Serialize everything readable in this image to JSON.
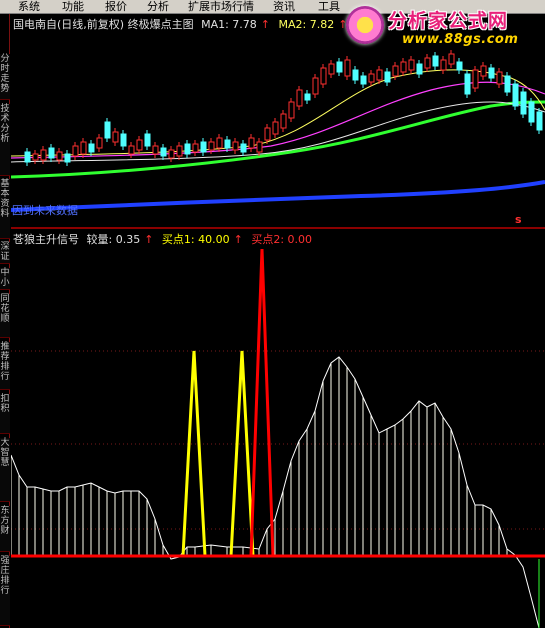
{
  "menu": [
    "系统",
    "功能",
    "报价",
    "分析",
    "扩展市场行情",
    "资讯",
    "工具"
  ],
  "left_tabs": [
    "分时走势",
    "技术分析",
    "基本资料",
    "深证",
    "中小",
    "同花顺",
    "推荐排行",
    "扣积",
    "大智慧",
    "东方财",
    "强庄排行"
  ],
  "main_header": {
    "title": "国电南自(日线,前复权) 终极爆点主图",
    "ma1_label": "MA1: 7.78",
    "ma2_label": "MA2: 7.82",
    "arrow": "↑"
  },
  "stub_text": "因到未来数据",
  "s_marker": "s",
  "indicator_header": {
    "name": "苍狼主升信号",
    "vol_label": "较量: 0.35",
    "buy1_label": "买点1: 40.00",
    "buy2_label": "买点2: 0.00",
    "arrow": "↑"
  },
  "watermark": {
    "line1": "分析家公式网",
    "line2": "www.88gs.com"
  },
  "colors": {
    "background": "#000000",
    "up_candle": "#ff3030",
    "down_candle": "#50ffff",
    "ma_short": "#ffffff",
    "ma_mid": "#ffff60",
    "ma_purple": "#ff40ff",
    "ma_green": "#30ff30",
    "ma_blue": "#2040ff",
    "buy1": "#ffff00",
    "buy2": "#ff0000",
    "indicator_line": "#ffffff"
  }
}
